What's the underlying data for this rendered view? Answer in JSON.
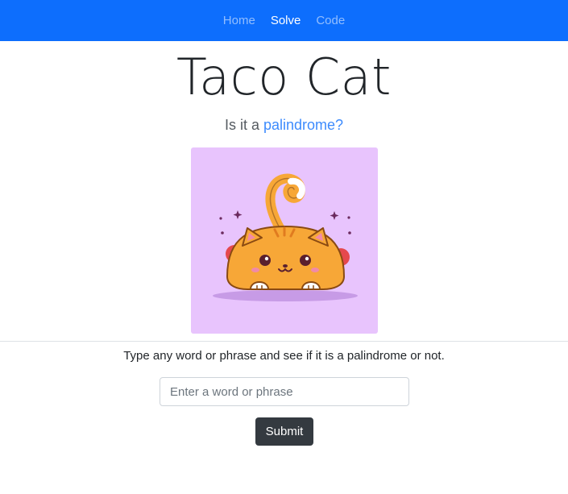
{
  "nav": {
    "items": [
      {
        "label": "Home",
        "active": false
      },
      {
        "label": "Solve",
        "active": true
      },
      {
        "label": "Code",
        "active": false
      }
    ],
    "color": "#0d6efd"
  },
  "header": {
    "title": "Taco Cat",
    "subtitle_prefix": "Is it a ",
    "subtitle_link": "palindrome?"
  },
  "image": {
    "icon": "taco-cat-illustration",
    "background": "#e8c4fd"
  },
  "form": {
    "instructions": "Type any word or phrase and see if it is a palindrome or not.",
    "input_placeholder": "Enter a word or phrase",
    "input_value": "",
    "submit_label": "Submit"
  }
}
